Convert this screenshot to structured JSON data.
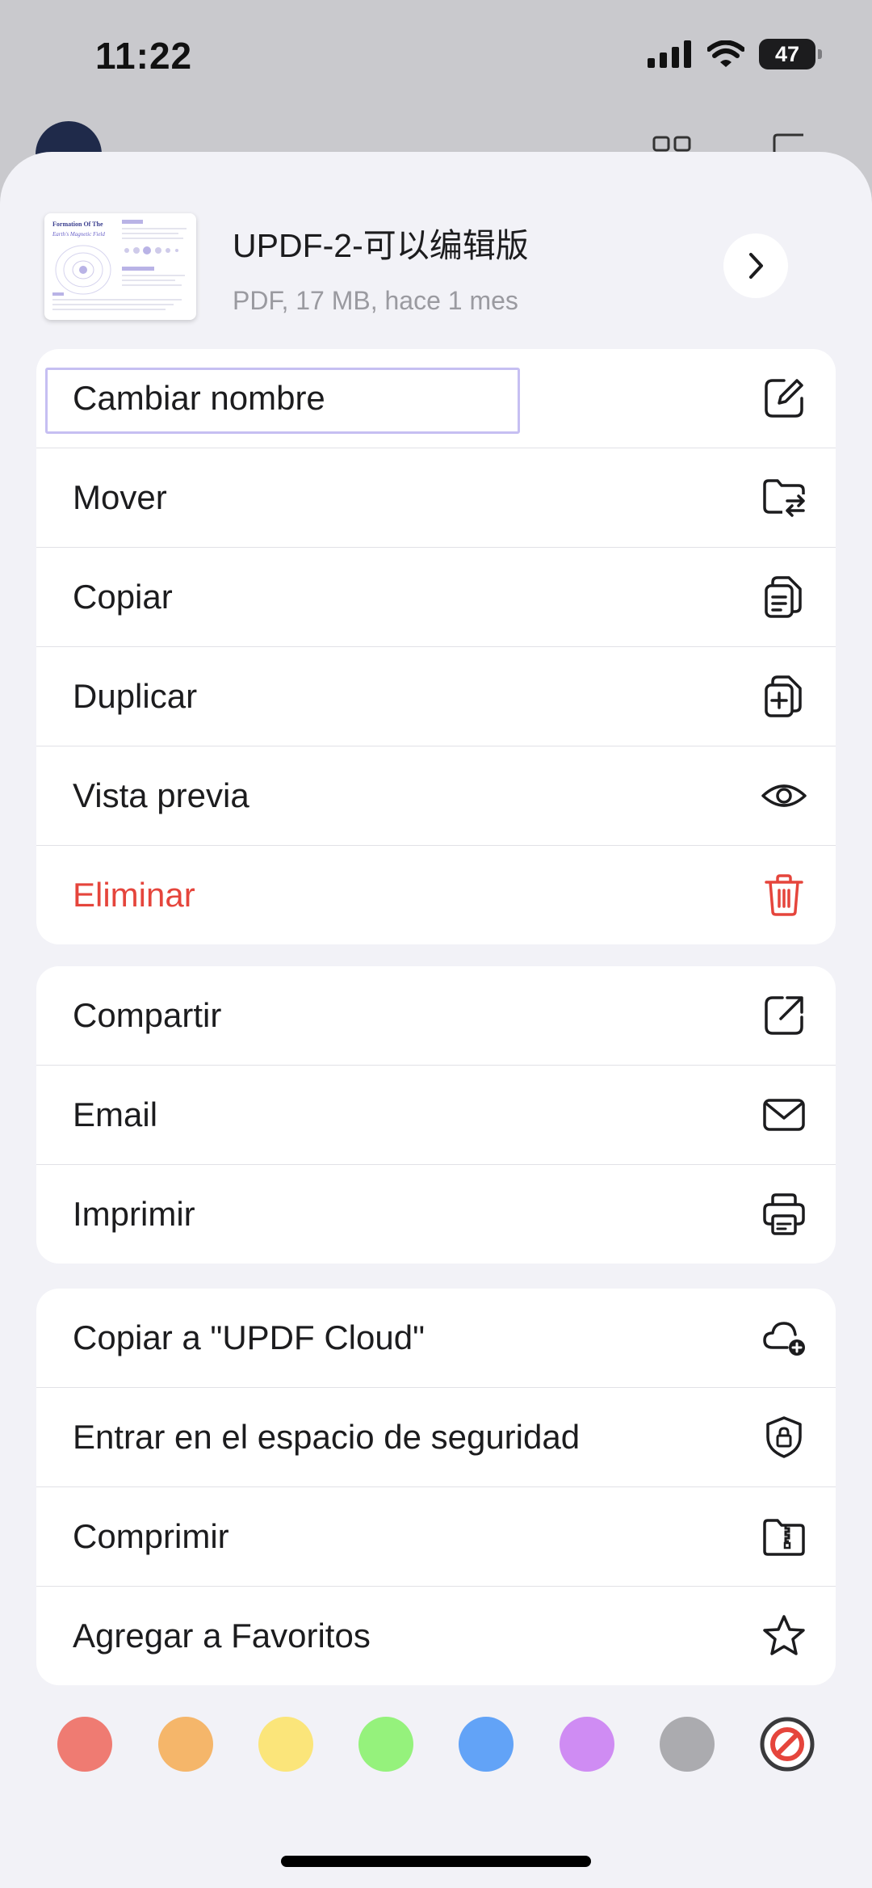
{
  "status_bar": {
    "time": "11:22",
    "battery": "47"
  },
  "file": {
    "title": "UPDF-2-可以编辑版",
    "meta": "PDF, 17 MB, hace 1 mes"
  },
  "groups": [
    {
      "items": [
        {
          "label": "Cambiar nombre",
          "icon": "edit-icon"
        },
        {
          "label": "Mover",
          "icon": "folder-move-icon"
        },
        {
          "label": "Copiar",
          "icon": "copy-icon"
        },
        {
          "label": "Duplicar",
          "icon": "duplicate-icon"
        },
        {
          "label": "Vista previa",
          "icon": "eye-icon"
        },
        {
          "label": "Eliminar",
          "icon": "trash-icon",
          "color": "#e5453c"
        }
      ]
    },
    {
      "items": [
        {
          "label": "Compartir",
          "icon": "share-icon"
        },
        {
          "label": "Email",
          "icon": "mail-icon"
        },
        {
          "label": "Imprimir",
          "icon": "printer-icon"
        }
      ]
    },
    {
      "items": [
        {
          "label": "Copiar a \"UPDF Cloud\"",
          "icon": "cloud-add-icon"
        },
        {
          "label": "Entrar en el espacio de seguridad",
          "icon": "shield-lock-icon"
        },
        {
          "label": "Comprimir",
          "icon": "zip-folder-icon"
        },
        {
          "label": "Agregar a Favoritos",
          "icon": "star-icon"
        }
      ]
    }
  ],
  "color_tags": [
    "#ef7b72",
    "#f5b66a",
    "#fbe57a",
    "#95f27c",
    "#62a3f7",
    "#cf8cf3",
    "#ababaf"
  ],
  "no_color_icon": "no-color-icon",
  "thumbnail": {
    "heading_1": "Formation Of The",
    "heading_2": "Earth's Magnetic Field"
  }
}
